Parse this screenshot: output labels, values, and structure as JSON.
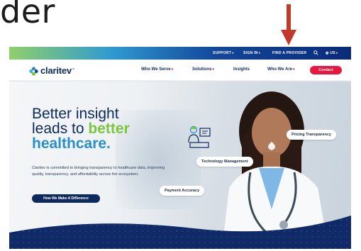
{
  "slide": {
    "title": "der"
  },
  "colors": {
    "brand_navy": "#0e2a5c",
    "accent_green": "#7cc63f",
    "accent_blue": "#2a8fc4",
    "contact_red": "#e8173f",
    "annotation_red": "#c0392b"
  },
  "utility_nav": {
    "support": "SUPPORT",
    "sign_in": "SIGN IN",
    "find_provider": "FIND A PROVIDER",
    "language": "US",
    "caret": "▾",
    "search_icon": "search-icon",
    "globe_icon": "globe-icon"
  },
  "main_nav": {
    "logo_text": "claritev",
    "logo_tm": "™",
    "items": [
      {
        "label": "Who We Serve",
        "caret": "▾"
      },
      {
        "label": "Solutions",
        "caret": "▾"
      },
      {
        "label": "Insights"
      },
      {
        "label": "Who We Are",
        "caret": "▾"
      }
    ],
    "contact": "Contact"
  },
  "hero": {
    "headline_line1": "Better insight",
    "headline_line2a": "leads to ",
    "headline_line2b": "better",
    "headline_line3": "healthcare.",
    "body": "Claritev is committed to bringing transparency to healthcare data, improving quality, transparency, and affordability across the ecosystem.",
    "cta": "How We Make A Difference",
    "badges": {
      "pricing": "Pricing Transparency",
      "technology": "Technology Management",
      "payment": "Payment Accuracy"
    }
  }
}
